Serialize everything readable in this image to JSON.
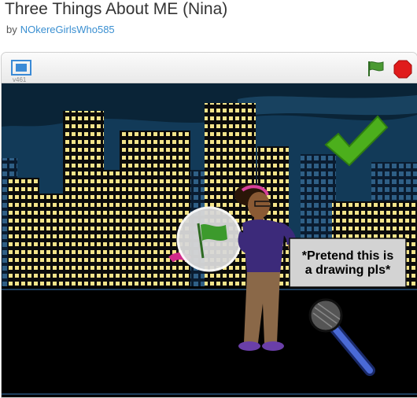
{
  "project": {
    "title": "Three Things About ME (Nina)",
    "by_label": "by",
    "author": "NOkereGirlsWho585"
  },
  "player": {
    "version_label": "v461",
    "fullscreen_icon": "fullscreen-icon",
    "green_flag_icon": "green-flag-icon",
    "stop_icon": "stop-sign-icon"
  },
  "stage": {
    "speech_line1": "*Pretend this is",
    "speech_line2": "a drawing pls*",
    "checkmark_icon": "checkmark-icon",
    "colors": {
      "sky": "#0f3551",
      "ground": "#000000",
      "checkmark": "#4caf1c",
      "flag_green": "#3c9a2c"
    }
  }
}
